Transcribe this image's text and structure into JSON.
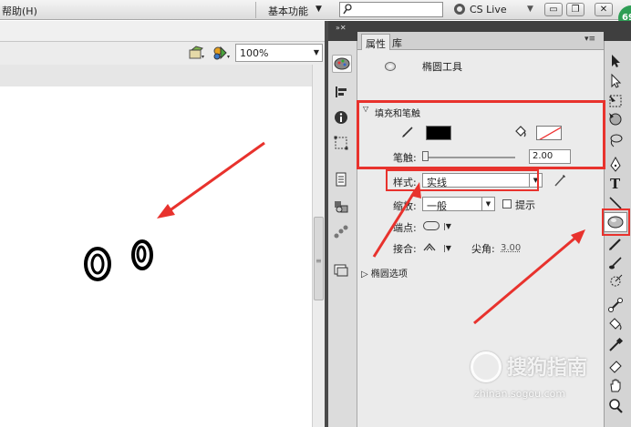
{
  "menubar": {
    "help_label": "帮助(H)",
    "workspace_label": "基本功能",
    "search": {
      "value": "",
      "placeholder": ""
    },
    "cslive_label": "CS Live"
  },
  "stage_toolbar": {
    "zoom_value": "100%"
  },
  "properties_panel": {
    "tabs": [
      {
        "label": "属性"
      },
      {
        "label": "库"
      }
    ],
    "tool_name": "椭圆工具",
    "fill_stroke_section": "填充和笔触",
    "stroke_label": "笔触:",
    "stroke_value": "2.00",
    "style_label": "样式:",
    "style_value": "实线",
    "scale_label": "缩放:",
    "scale_value": "一般",
    "hint_label": "提示",
    "cap_label": "端点:",
    "join_label": "接合:",
    "miter_label": "尖角:",
    "miter_value": "3.00",
    "ellipse_options_section": "椭圆选项"
  },
  "colors": {
    "stroke_color": "#000000",
    "fill_color": "none",
    "annotation_red": "#e8322d"
  },
  "watermark": {
    "brand": "搜狗指南",
    "url": "zhinan.sogou.com"
  },
  "badge": "69"
}
